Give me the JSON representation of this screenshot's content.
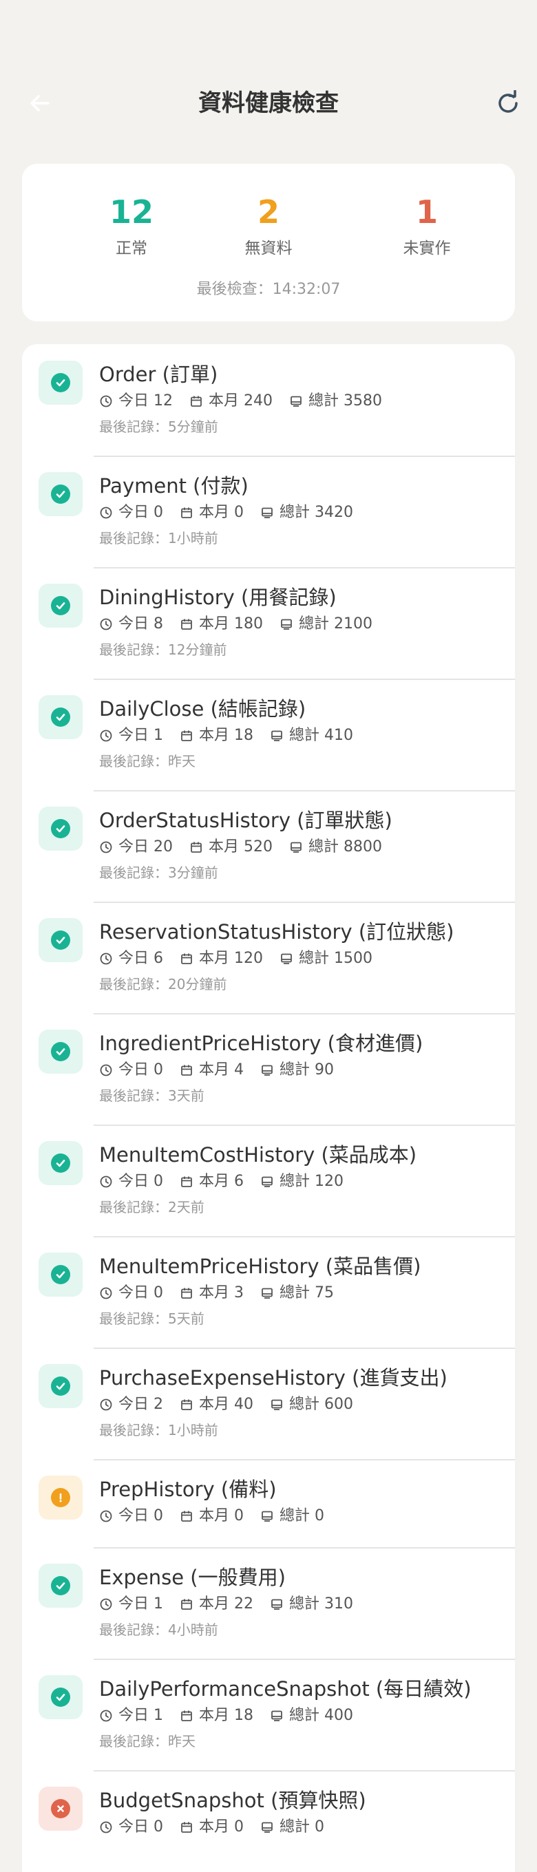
{
  "header": {
    "title": "資料健康檢查",
    "back_icon": "arrow-left-icon",
    "refresh_icon": "refresh-icon"
  },
  "summary": {
    "normal": {
      "value": "12",
      "label": "正常",
      "color": "#19b394"
    },
    "no_data": {
      "value": "2",
      "label": "無資料",
      "color": "#f0a01e"
    },
    "not_implemented": {
      "value": "1",
      "label": "未實作",
      "color": "#e0644a"
    },
    "last_check": "最後檢查：14:32:07"
  },
  "colors": {
    "ok": "#19b394",
    "ok_bg": "#e3f6f0",
    "warn": "#f0a01e",
    "warn_bg": "#fdf1dc",
    "error": "#e0644a",
    "error_bg": "#fbe5e0"
  },
  "labels": {
    "today": "今日",
    "month": "本月",
    "total": "總計"
  },
  "items": [
    {
      "title": "Order (訂單)",
      "status": "ok",
      "today": "今日 12",
      "month": "本月 240",
      "total": "總計 3580",
      "last": "最後記錄：5分鐘前"
    },
    {
      "title": "Payment (付款)",
      "status": "ok",
      "today": "今日 0",
      "month": "本月 0",
      "total": "總計 3420",
      "last": "最後記錄：1小時前"
    },
    {
      "title": "DiningHistory (用餐記錄)",
      "status": "ok",
      "today": "今日 8",
      "month": "本月 180",
      "total": "總計 2100",
      "last": "最後記錄：12分鐘前"
    },
    {
      "title": "DailyClose (結帳記錄)",
      "status": "ok",
      "today": "今日 1",
      "month": "本月 18",
      "total": "總計 410",
      "last": "最後記錄：昨天"
    },
    {
      "title": "OrderStatusHistory (訂單狀態)",
      "status": "ok",
      "today": "今日 20",
      "month": "本月 520",
      "total": "總計 8800",
      "last": "最後記錄：3分鐘前"
    },
    {
      "title": "ReservationStatusHistory (訂位狀態)",
      "status": "ok",
      "today": "今日 6",
      "month": "本月 120",
      "total": "總計 1500",
      "last": "最後記錄：20分鐘前"
    },
    {
      "title": "IngredientPriceHistory (食材進價)",
      "status": "ok",
      "today": "今日 0",
      "month": "本月 4",
      "total": "總計 90",
      "last": "最後記錄：3天前"
    },
    {
      "title": "MenuItemCostHistory (菜品成本)",
      "status": "ok",
      "today": "今日 0",
      "month": "本月 6",
      "total": "總計 120",
      "last": "最後記錄：2天前"
    },
    {
      "title": "MenuItemPriceHistory (菜品售價)",
      "status": "ok",
      "today": "今日 0",
      "month": "本月 3",
      "total": "總計 75",
      "last": "最後記錄：5天前"
    },
    {
      "title": "PurchaseExpenseHistory (進貨支出)",
      "status": "ok",
      "today": "今日 2",
      "month": "本月 40",
      "total": "總計 600",
      "last": "最後記錄：1小時前"
    },
    {
      "title": "PrepHistory (備料)",
      "status": "warn",
      "today": "今日 0",
      "month": "本月 0",
      "total": "總計 0",
      "last": ""
    },
    {
      "title": "Expense (一般費用)",
      "status": "ok",
      "today": "今日 1",
      "month": "本月 22",
      "total": "總計 310",
      "last": "最後記錄：4小時前"
    },
    {
      "title": "DailyPerformanceSnapshot (每日績效)",
      "status": "ok",
      "today": "今日 1",
      "month": "本月 18",
      "total": "總計 400",
      "last": "最後記錄：昨天"
    },
    {
      "title": "BudgetSnapshot (預算快照)",
      "status": "error",
      "today": "今日 0",
      "month": "本月 0",
      "total": "總計 0",
      "last": ""
    }
  ]
}
